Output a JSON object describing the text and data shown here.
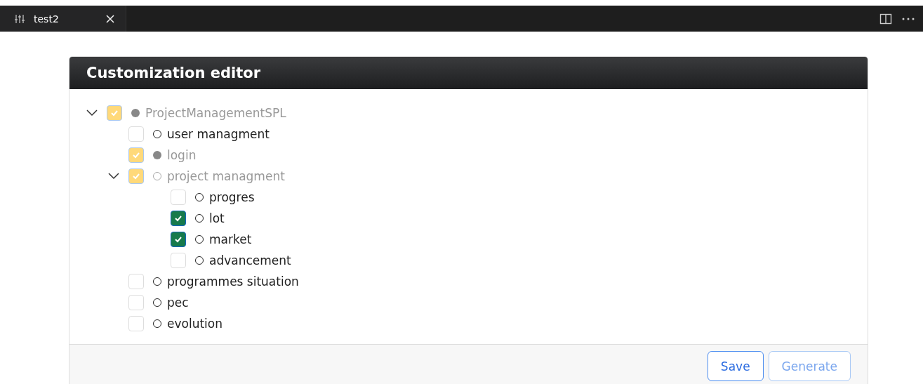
{
  "tab": {
    "title": "test2"
  },
  "editor": {
    "title": "Customization editor",
    "tree": [
      {
        "label": "ProjectManagementSPL",
        "checked": true,
        "locked": true,
        "mandatory": true,
        "expanded": true,
        "children": [
          {
            "label": "user managment",
            "checked": false,
            "locked": false,
            "mandatory": false
          },
          {
            "label": "login",
            "checked": true,
            "locked": true,
            "mandatory": true
          },
          {
            "label": "project managment",
            "checked": true,
            "locked": true,
            "mandatory": false,
            "expanded": true,
            "children": [
              {
                "label": "progres",
                "checked": false,
                "locked": false,
                "mandatory": false
              },
              {
                "label": "lot",
                "checked": true,
                "locked": false,
                "mandatory": false
              },
              {
                "label": "market",
                "checked": true,
                "locked": false,
                "mandatory": false
              },
              {
                "label": "advancement",
                "checked": false,
                "locked": false,
                "mandatory": false
              }
            ]
          },
          {
            "label": "programmes situation",
            "checked": false,
            "locked": false,
            "mandatory": false
          },
          {
            "label": "pec",
            "checked": false,
            "locked": false,
            "mandatory": false
          },
          {
            "label": "evolution",
            "checked": false,
            "locked": false,
            "mandatory": false
          }
        ]
      }
    ],
    "buttons": [
      {
        "label": "Save",
        "disabled": false
      },
      {
        "label": "Generate",
        "disabled": true
      }
    ]
  }
}
